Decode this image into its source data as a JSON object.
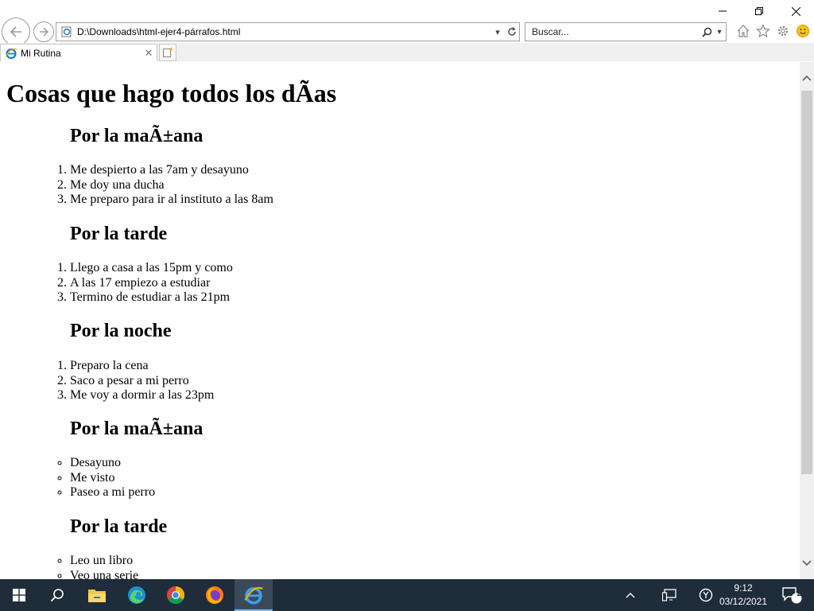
{
  "window": {
    "controls": [
      "minimize",
      "restore",
      "close"
    ]
  },
  "address_bar": {
    "url": "D:\\Downloads\\html-ejer4-párrafos.html"
  },
  "search": {
    "placeholder": "Buscar..."
  },
  "tab": {
    "title": "Mi Rutina"
  },
  "page": {
    "heading": "Cosas que hago todos los dÃas",
    "sections": [
      {
        "title": "Por la maÃ±ana",
        "list_type": "ordered",
        "items": [
          "Me despierto a las 7am y desayuno",
          "Me doy una ducha",
          "Me preparo para ir al instituto a las 8am"
        ]
      },
      {
        "title": "Por la tarde",
        "list_type": "ordered",
        "items": [
          "Llego a casa a las 15pm y como",
          "A las 17 empiezo a estudiar",
          "Termino de estudiar a las 21pm"
        ]
      },
      {
        "title": "Por la noche",
        "list_type": "ordered",
        "items": [
          "Preparo la cena",
          "Saco a pesar a mi perro",
          "Me voy a dormir a las 23pm"
        ]
      },
      {
        "title": "Por la maÃ±ana",
        "list_type": "unordered",
        "items": [
          "Desayuno",
          "Me visto",
          "Paseo a mi perro"
        ]
      },
      {
        "title": "Por la tarde",
        "list_type": "unordered",
        "items": [
          "Leo un libro",
          "Veo una serie"
        ]
      }
    ]
  },
  "taskbar": {
    "apps": [
      "start-icon",
      "search-icon",
      "file-explorer-icon",
      "edge-icon",
      "chrome-icon",
      "firefox-icon",
      "internet-explorer-icon"
    ],
    "active_app": "internet-explorer-icon",
    "clock": {
      "time": "9:12",
      "date": "03/12/2021"
    },
    "notification_count": "2"
  },
  "colors": {
    "taskbar_bg": "#1f2c3a",
    "active_underline": "#76b9ed",
    "scroll_thumb": "#cdcdcd"
  }
}
